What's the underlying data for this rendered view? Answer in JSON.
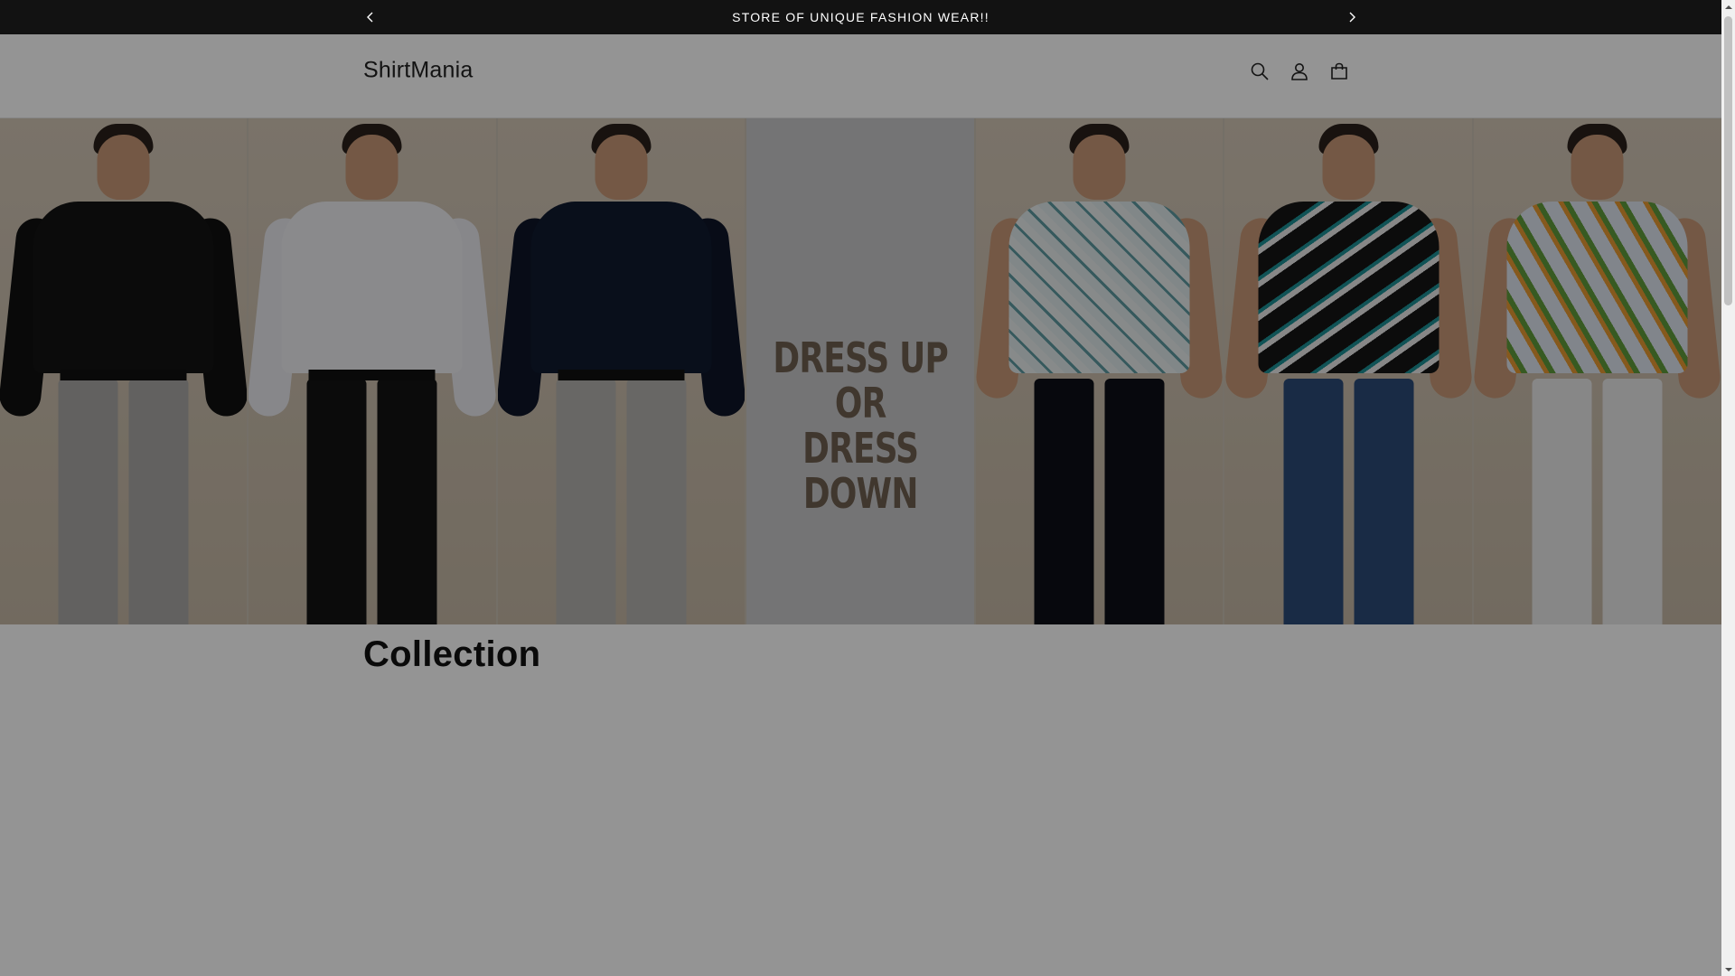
{
  "announcement": {
    "text": "STORE OF UNIQUE FASHION WEAR!!",
    "prev_icon": "chevron-left-icon",
    "next_icon": "chevron-right-icon"
  },
  "header": {
    "logo": "ShirtMania",
    "icons": [
      "search-icon",
      "account-icon",
      "cart-icon"
    ]
  },
  "hero": {
    "line1": "DRESS UP OR",
    "line2": "DRESS DOWN"
  },
  "collection": {
    "title": "Collection"
  },
  "colors": {
    "announcement_bg": "#121212",
    "text": "#121212",
    "hero_beige": "#c9bcaa",
    "hero_text": "#6f5f50"
  }
}
